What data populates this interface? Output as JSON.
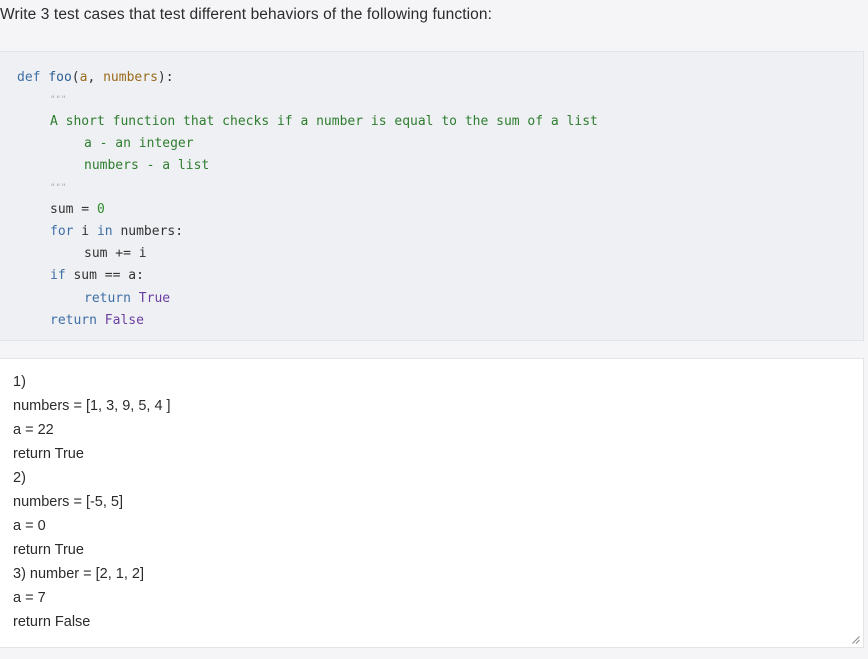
{
  "prompt": "Write 3 test cases that test different behaviors of the following function:",
  "code": {
    "line1": {
      "kw": "def",
      "fn": "foo",
      "open": "(",
      "arg1": "a",
      "comma": ", ",
      "arg2": "numbers",
      "close": "):"
    },
    "docstring_open": "\"\"\"",
    "doc_line1": "A short function that checks if a number is equal to the sum of a list",
    "doc_line2": "a - an integer",
    "doc_line3": "numbers - a list",
    "docstring_close": "\"\"\"",
    "sum_init": {
      "id": "sum",
      "op": " = ",
      "num": "0"
    },
    "for_line": {
      "kw1": "for",
      "id": " i ",
      "kw2": "in",
      "rest": " numbers:"
    },
    "sum_add": {
      "id": "sum",
      "op": " += ",
      "var": "i"
    },
    "if_line": {
      "kw": "if",
      "rest": " sum == a:"
    },
    "return_true": {
      "kw": "return",
      "val": "True"
    },
    "return_false": {
      "kw": "return",
      "val": "False"
    }
  },
  "answer": {
    "lines": [
      "1)",
      "numbers = [1, 3, 9, 5, 4 ]",
      "a = 22",
      "return True",
      "2)",
      "numbers = [-5, 5]",
      "a = 0",
      "return True",
      "3) number = [2, 1, 2]",
      "a = 7",
      "return False"
    ]
  }
}
